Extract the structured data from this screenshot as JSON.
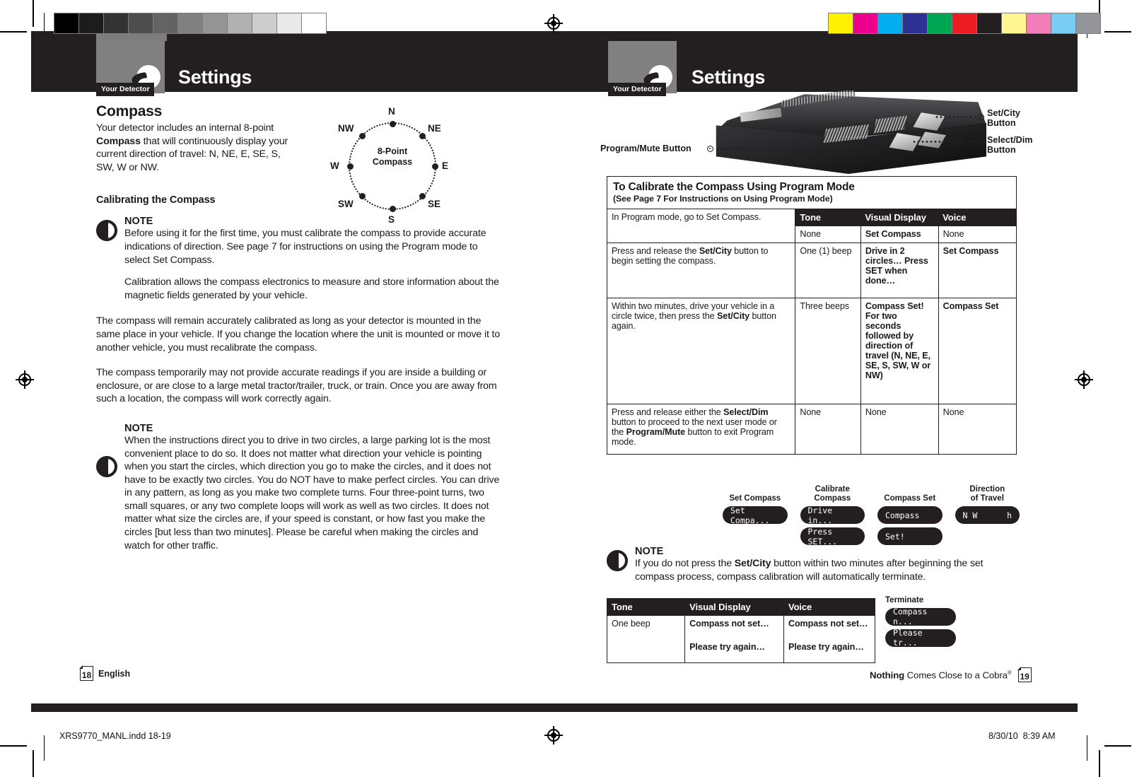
{
  "print_marks": {
    "gray_swatches": [
      "#000000",
      "#1c1c1c",
      "#333333",
      "#4d4d4d",
      "#636363",
      "#808080",
      "#949494",
      "#b0b0b0",
      "#cdcdcd",
      "#e9e9e9",
      "#ffffff"
    ],
    "color_swatches": [
      "#fff200",
      "#ec008c",
      "#00aeef",
      "#2e3192",
      "#00a651",
      "#ed1c24",
      "#231f20",
      "#fff68f",
      "#f47cb8",
      "#79cdf3",
      "#939598"
    ]
  },
  "left_page": {
    "header": {
      "title": "Settings",
      "tab_label": "Your Detector",
      "logo_icon": "cobra-snake-icon"
    },
    "section_title": "Compass",
    "intro": "Your detector includes an internal 8-point Compass that will continuously display your current direction of travel: N, NE, E, SE, S, SW, W or NW.",
    "intro_parts": [
      {
        "text": "Your detector includes an internal ",
        "bold": false
      },
      {
        "text": "8-point ",
        "bold": false
      },
      {
        "text": "Compass",
        "bold": true
      },
      {
        "text": " that will continuously display your current direction of travel: N, NE, E, SE, S, SW, W or NW.",
        "bold": false
      }
    ],
    "compass_diagram": {
      "center_label_line1": "8-Point",
      "center_label_line2": "Compass",
      "points": [
        "N",
        "NE",
        "E",
        "SE",
        "S",
        "SW",
        "W",
        "NW"
      ]
    },
    "calibrating_heading": "Calibrating the Compass",
    "note1": {
      "label": "NOTE",
      "icon": "note-bell-icon",
      "paragraph1_pre": "Before using it for the first time, you must calibrate the compass to provide accurate indications of direction. See page 7 for instructions on using the Program mode to select Set Compass.",
      "paragraph2": "Calibration allows the compass electronics to measure and store information about the magnetic fields generated by your vehicle."
    },
    "paragraph_remain": "The compass will remain accurately calibrated as long as your detector is mounted in the same place in your vehicle. If you change the location where the unit is mounted or move it to another vehicle, you must recalibrate the compass.",
    "paragraph_temporary": "The compass temporarily may not provide accurate readings if you are inside a building or enclosure, or are close to a large metal tractor/trailer, truck, or train. Once you are away from such a location, the compass will work correctly again.",
    "note2": {
      "label": "NOTE",
      "icon": "note-bell-icon",
      "text": "When the instructions direct you to drive in two circles, a large parking lot is the most convenient place to do so. It does not matter what direction your vehicle is pointing when you start the circles, which direction you go to make the circles, and it does not have to be exactly two circles. You do NOT have to make perfect circles. You can drive in any pattern, as long as you make two complete turns. Four three-point turns, two small squares, or any two complete loops will work as well as two circles. It does not matter what size the circles are, if your speed is constant, or how fast you make the circles [but less than two minutes]. Please be careful when making the circles and watch for other traffic."
    },
    "footer": {
      "page_number": "18",
      "language": "English"
    }
  },
  "right_page": {
    "header": {
      "title": "Settings",
      "tab_label": "Your Detector",
      "logo_icon": "cobra-snake-icon"
    },
    "callouts": {
      "program_mute": "Program/Mute Button",
      "set_city_line1": "Set/City",
      "set_city_line2": "Button",
      "select_dim_line1": "Select/Dim",
      "select_dim_line2": "Button"
    },
    "table": {
      "caption_title": "To Calibrate the Compass Using Program Mode",
      "caption_sub": "(See Page 7 For Instructions on Using Program Mode)",
      "columns": [
        "Tone",
        "Visual Display",
        "Voice"
      ],
      "rows": [
        {
          "action_parts": [
            {
              "text": "In Program mode, go to Set Compass.",
              "bold": false
            }
          ],
          "tone": "None",
          "visual": "Set Compass",
          "visual_bold": true,
          "voice": "None",
          "voice_bold": false
        },
        {
          "action_parts": [
            {
              "text": "Press and release the ",
              "bold": false
            },
            {
              "text": "Set/City",
              "bold": true
            },
            {
              "text": " button to begin setting the compass.",
              "bold": false
            }
          ],
          "tone": "One (1) beep",
          "visual": "Drive in 2 circles… Press SET when done…",
          "visual_bold": true,
          "voice": "Set Compass",
          "voice_bold": true
        },
        {
          "action_parts": [
            {
              "text": "Within two minutes, drive your vehicle in a circle twice, then press the ",
              "bold": false
            },
            {
              "text": "Set/City",
              "bold": true
            },
            {
              "text": " button again.",
              "bold": false
            }
          ],
          "tone": "Three beeps",
          "visual": "Compass Set! For two seconds followed by direction of travel (N, NE, E, SE, S, SW, W or NW)",
          "visual_bold": true,
          "voice": "Compass Set",
          "voice_bold": true
        },
        {
          "action_parts": [
            {
              "text": "Press and release either the ",
              "bold": false
            },
            {
              "text": "Select/Dim",
              "bold": true
            },
            {
              "text": " button to proceed to the next user mode or the ",
              "bold": false
            },
            {
              "text": "Program/Mute",
              "bold": true
            },
            {
              "text": " button to exit Program mode.",
              "bold": false
            }
          ],
          "tone": "None",
          "visual": "None",
          "visual_bold": false,
          "voice": "None",
          "voice_bold": false
        }
      ]
    },
    "lcd_groups": [
      {
        "label_line1": "Set Compass",
        "label_line2": "",
        "screens": [
          "Set Compa..."
        ]
      },
      {
        "label_line1": "Calibrate",
        "label_line2": "Compass",
        "screens": [
          "Drive in...",
          "Press SET..."
        ]
      },
      {
        "label_line1": "Compass Set",
        "label_line2": "",
        "screens": [
          "Compass",
          "Set!"
        ]
      },
      {
        "label_line1": "Direction",
        "label_line2": "of Travel",
        "screens": [
          "N W        h"
        ]
      }
    ],
    "note": {
      "label": "NOTE",
      "icon": "note-bell-icon",
      "parts": [
        {
          "text": "If you do not press the ",
          "bold": false
        },
        {
          "text": "Set/City",
          "bold": true
        },
        {
          "text": " button within two minutes after beginning the set compass process, compass calibration will automatically terminate.",
          "bold": false
        }
      ]
    },
    "terminate_table": {
      "columns": [
        "Tone",
        "Visual Display",
        "Voice"
      ],
      "rows": [
        {
          "tone": "One beep",
          "visual": "Compass not set…",
          "voice": "Compass not set…"
        },
        {
          "tone": "",
          "visual": "Please try again…",
          "voice": "Please try again…"
        }
      ]
    },
    "terminate_lcd": {
      "label": "Terminate",
      "screens": [
        "Compass n...",
        "Please tr..."
      ]
    },
    "footer": {
      "tagline_bold": "Nothing",
      "tagline_rest": " Comes Close to a Cobra",
      "tagline_mark": "®",
      "page_number": "19"
    }
  },
  "print_footer": {
    "filename": "XRS9770_MANL.indd   18-19",
    "date": "8/30/10",
    "time": "8:39 AM"
  }
}
